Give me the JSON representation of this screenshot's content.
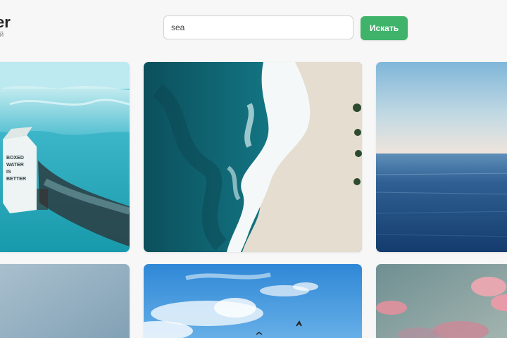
{
  "header": {
    "logo_title": "er",
    "logo_subtitle": "ий"
  },
  "search": {
    "value": "sea",
    "button_label": "Искать"
  },
  "photo_box_text": {
    "line1": "BOXED",
    "line2": "WATER",
    "line3": "IS",
    "line4": "BETTER"
  },
  "colors": {
    "accent": "#3fb36a",
    "background": "#f7f7f7"
  }
}
